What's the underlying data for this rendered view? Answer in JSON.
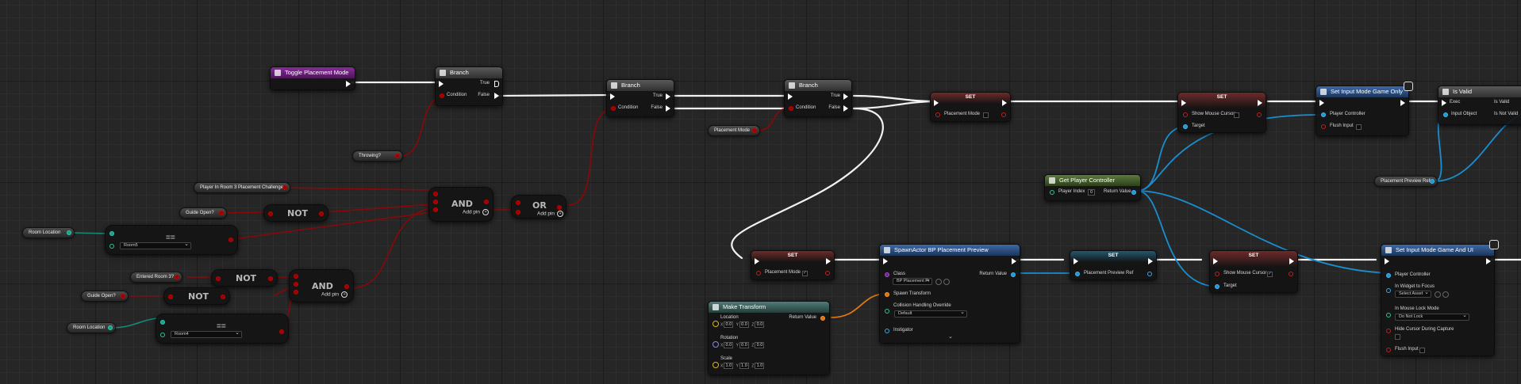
{
  "nodes": {
    "toggle_event": {
      "title": "Toggle Placement Mode"
    },
    "branch1": {
      "title": "Branch",
      "true": "True",
      "false": "False",
      "condition": "Condition"
    },
    "branch2": {
      "title": "Branch",
      "true": "True",
      "false": "False",
      "condition": "Condition"
    },
    "branch3": {
      "title": "Branch",
      "true": "True",
      "false": "False",
      "condition": "Condition"
    },
    "set_placement1": {
      "title": "SET",
      "pin": "Placement Mode"
    },
    "set_cursor1": {
      "title": "SET",
      "pin": "Show Mouse Cursor",
      "target": "Target"
    },
    "set_input_game_only": {
      "title": "Set Input Mode Game Only",
      "pin1": "Player Controller",
      "pin2": "Flush Input"
    },
    "is_valid": {
      "title": "Is Valid",
      "exec": "Exec",
      "is_valid": "Is Valid",
      "input_object": "Input Object",
      "is_not_valid": "Is Not Valid"
    },
    "get_player_controller": {
      "title": "Get Player Controller",
      "player_index_label": "Player Index",
      "player_index": "0",
      "return_value": "Return Value"
    },
    "and1": {
      "op": "AND",
      "add_pin": "Add pin"
    },
    "or1": {
      "op": "OR",
      "add_pin": "Add pin"
    },
    "not1": {
      "op": "NOT"
    },
    "equal1": {
      "op": "==",
      "room": "Room5"
    },
    "not2": {
      "op": "NOT"
    },
    "not3": {
      "op": "NOT"
    },
    "and2": {
      "op": "AND",
      "add_pin": "Add pin"
    },
    "equal2": {
      "op": "==",
      "room": "Room4"
    },
    "set_placement2": {
      "title": "SET",
      "pin": "Placement Mode",
      "checked": "✓"
    },
    "spawn_actor": {
      "title": "SpawnActor BP Placement Preview",
      "class_label": "Class",
      "class_value": "BP Placement Pr",
      "return_value": "Return Value",
      "spawn_transform": "Spawn Transform",
      "collision_label": "Collision Handling Override",
      "collision_value": "Default",
      "instigator": "Instigator"
    },
    "set_preview_ref": {
      "title": "SET",
      "pin": "Placement Preview Ref"
    },
    "set_cursor2": {
      "title": "SET",
      "pin": "Show Mouse Cursor",
      "checked": "✓",
      "target": "Target"
    },
    "set_input_game_ui": {
      "title": "Set Input Mode Game And UI",
      "pin1": "Player Controller",
      "pin2": "In Widget to Focus",
      "pin2_value": "Select Asset",
      "pin3": "In Mouse Lock Mode",
      "pin3_value": "Do Not Lock",
      "pin4": "Hide Cursor During Capture",
      "pin5": "Flush Input"
    },
    "make_transform": {
      "title": "Make Transform",
      "return_value": "Return Value",
      "location_label": "Location",
      "location": [
        "0.0",
        "0.0",
        "0.0"
      ],
      "rotation_label": "Rotation",
      "rotation": [
        "0.0",
        "0.0",
        "0.0"
      ],
      "scale_label": "Scale",
      "scale": [
        "1.0",
        "1.0",
        "1.0"
      ],
      "axis": [
        "X",
        "Y",
        "Z"
      ]
    }
  },
  "variables": {
    "throwing": "Throwing?",
    "placement_mode": "Placement Mode",
    "player_in_room": "Player In Room 3 Placement Challenge",
    "guide_open1": "Guide Open?",
    "room_location1": "Room Location",
    "entered_room": "Entered Room 3?",
    "guide_open2": "Guide Open?",
    "room_location2": "Room Location",
    "preview_ref": "Placement Preview Ref"
  }
}
